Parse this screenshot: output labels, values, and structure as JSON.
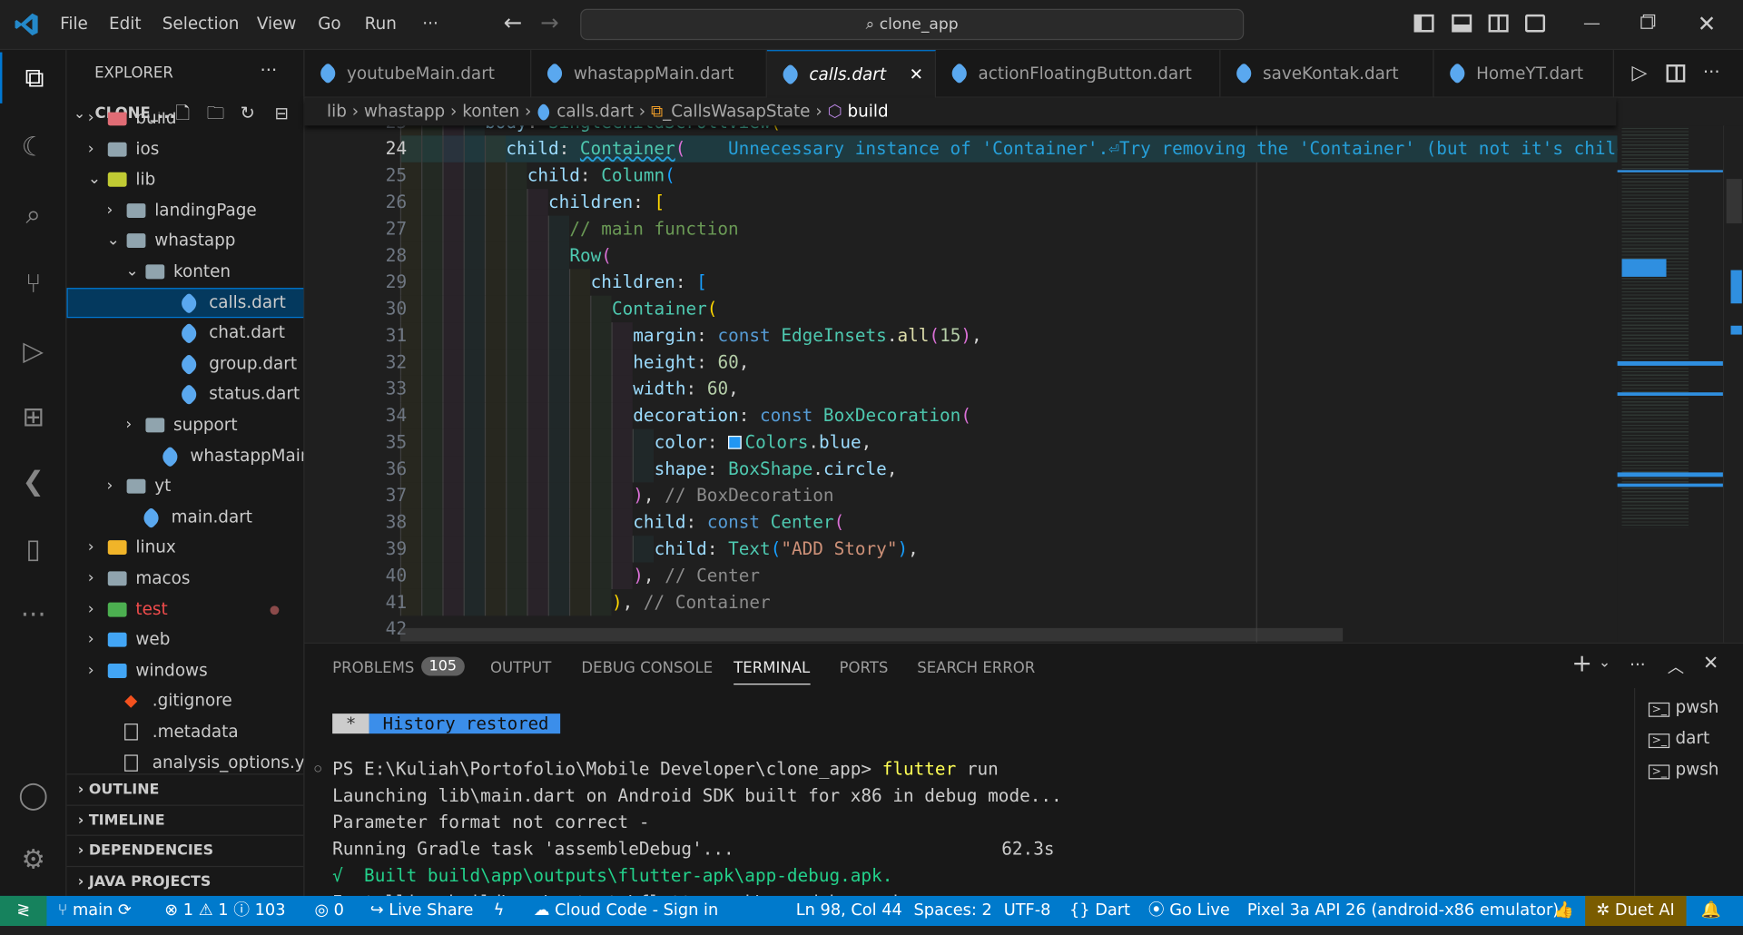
{
  "titlebar": {
    "menus": [
      "File",
      "Edit",
      "Selection",
      "View",
      "Go",
      "Run",
      "···"
    ],
    "search": "⌕ clone_app",
    "back_icon": "←",
    "forward_icon": "→"
  },
  "activity": {
    "items": [
      "explorer-icon",
      "run-history-icon",
      "search-icon",
      "source-control-icon",
      "run-debug-icon",
      "extensions-icon",
      "flutter-icon",
      "device-icon",
      "more-icon"
    ],
    "bottom": [
      "accounts-icon",
      "settings-icon"
    ]
  },
  "sidebar": {
    "title": "EXPLORER",
    "more": "···",
    "root": "CLONE_...",
    "items": [
      {
        "label": "build",
        "depth": 0,
        "type": "folder",
        "color": "#e06c75"
      },
      {
        "label": "ios",
        "depth": 0,
        "type": "folder"
      },
      {
        "label": "lib",
        "depth": 0,
        "type": "folder-open",
        "color": "#c0ca33"
      },
      {
        "label": "landingPage",
        "depth": 1,
        "type": "folder"
      },
      {
        "label": "whastapp",
        "depth": 1,
        "type": "folder-open"
      },
      {
        "label": "konten",
        "depth": 2,
        "type": "folder-open"
      },
      {
        "label": "calls.dart",
        "depth": 3,
        "type": "dart",
        "selected": true
      },
      {
        "label": "chat.dart",
        "depth": 3,
        "type": "dart"
      },
      {
        "label": "group.dart",
        "depth": 3,
        "type": "dart"
      },
      {
        "label": "status.dart",
        "depth": 3,
        "type": "dart"
      },
      {
        "label": "support",
        "depth": 2,
        "type": "folder"
      },
      {
        "label": "whastappMain....",
        "depth": 2,
        "type": "dart"
      },
      {
        "label": "yt",
        "depth": 1,
        "type": "folder"
      },
      {
        "label": "main.dart",
        "depth": 1,
        "type": "dart"
      },
      {
        "label": "linux",
        "depth": 0,
        "type": "folder",
        "color": "#f0b429"
      },
      {
        "label": "macos",
        "depth": 0,
        "type": "folder"
      },
      {
        "label": "test",
        "depth": 0,
        "type": "folder",
        "color": "#4caf50",
        "text_color": "#f14c4c",
        "dot": true
      },
      {
        "label": "web",
        "depth": 0,
        "type": "folder",
        "color": "#42a5f5"
      },
      {
        "label": "windows",
        "depth": 0,
        "type": "folder",
        "color": "#42a5f5"
      },
      {
        "label": ".gitignore",
        "depth": 0,
        "type": "git"
      },
      {
        "label": ".metadata",
        "depth": 0,
        "type": "file"
      },
      {
        "label": "analysis_options.y...",
        "depth": 0,
        "type": "file"
      }
    ],
    "sections": [
      "OUTLINE",
      "TIMELINE",
      "DEPENDENCIES",
      "JAVA PROJECTS"
    ]
  },
  "tabs": [
    {
      "label": "youtubeMain.dart"
    },
    {
      "label": "whastappMain.dart"
    },
    {
      "label": "calls.dart",
      "active": true
    },
    {
      "label": "actionFloatingButton.dart"
    },
    {
      "label": "saveKontak.dart"
    },
    {
      "label": "HomeYT.dart"
    }
  ],
  "breadcrumb": [
    "lib",
    "whastapp",
    "konten",
    "calls.dart",
    "_CallsWasapState",
    "build"
  ],
  "editor": {
    "lines": [
      {
        "n": "23",
        "indent": 8,
        "t": [
          [
            "body",
            "p"
          ],
          [
            ": ",
            "d"
          ],
          [
            "SingleChildScrollView",
            "c"
          ],
          [
            "(",
            "b1"
          ]
        ]
      },
      {
        "n": "24",
        "indent": 10,
        "current": true,
        "t": [
          [
            "child",
            "p"
          ],
          [
            ": ",
            "d"
          ],
          [
            "Container",
            "c"
          ],
          [
            "(",
            "b2"
          ],
          [
            "    Unnecessary instance of 'Container'.⏎Try removing the 'Container' (but not it's children) from the widget tree.",
            "diag"
          ]
        ]
      },
      {
        "n": "25",
        "indent": 12,
        "t": [
          [
            "child",
            "p"
          ],
          [
            ": ",
            "d"
          ],
          [
            "Column",
            "c"
          ],
          [
            "(",
            "b3"
          ]
        ]
      },
      {
        "n": "26",
        "indent": 14,
        "t": [
          [
            "children",
            "p"
          ],
          [
            ": ",
            "d"
          ],
          [
            "[",
            "b1"
          ]
        ]
      },
      {
        "n": "27",
        "indent": 16,
        "t": [
          [
            "// main function",
            "cm"
          ]
        ]
      },
      {
        "n": "28",
        "indent": 16,
        "t": [
          [
            "Row",
            "c"
          ],
          [
            "(",
            "b2"
          ]
        ]
      },
      {
        "n": "29",
        "indent": 18,
        "t": [
          [
            "children",
            "p"
          ],
          [
            ": ",
            "d"
          ],
          [
            "[",
            "b3"
          ]
        ]
      },
      {
        "n": "30",
        "indent": 20,
        "t": [
          [
            "Container",
            "c"
          ],
          [
            "(",
            "b1"
          ]
        ]
      },
      {
        "n": "31",
        "indent": 22,
        "t": [
          [
            "margin",
            "p"
          ],
          [
            ": ",
            "d"
          ],
          [
            "const ",
            "k"
          ],
          [
            "EdgeInsets",
            "c"
          ],
          [
            ".",
            "d"
          ],
          [
            "all",
            "f"
          ],
          [
            "(",
            "b2"
          ],
          [
            "15",
            "n"
          ],
          [
            ")",
            "b2"
          ],
          [
            ",",
            "d"
          ]
        ]
      },
      {
        "n": "32",
        "indent": 22,
        "t": [
          [
            "height",
            "p"
          ],
          [
            ": ",
            "d"
          ],
          [
            "60",
            "n"
          ],
          [
            ",",
            "d"
          ]
        ]
      },
      {
        "n": "33",
        "indent": 22,
        "t": [
          [
            "width",
            "p"
          ],
          [
            ": ",
            "d"
          ],
          [
            "60",
            "n"
          ],
          [
            ",",
            "d"
          ]
        ]
      },
      {
        "n": "34",
        "indent": 22,
        "t": [
          [
            "decoration",
            "p"
          ],
          [
            ": ",
            "d"
          ],
          [
            "const ",
            "k"
          ],
          [
            "BoxDecoration",
            "c"
          ],
          [
            "(",
            "b2"
          ]
        ]
      },
      {
        "n": "35",
        "indent": 24,
        "swatch": "#2196f3",
        "t": [
          [
            "color",
            "p"
          ],
          [
            ": ",
            "d"
          ],
          [
            "Colors",
            "c"
          ],
          [
            ".",
            "d"
          ],
          [
            "blue",
            "p"
          ],
          [
            ",",
            "d"
          ]
        ]
      },
      {
        "n": "36",
        "indent": 24,
        "t": [
          [
            "shape",
            "p"
          ],
          [
            ": ",
            "d"
          ],
          [
            "BoxShape",
            "c"
          ],
          [
            ".",
            "d"
          ],
          [
            "circle",
            "p"
          ],
          [
            ",",
            "d"
          ]
        ]
      },
      {
        "n": "37",
        "indent": 22,
        "t": [
          [
            ")",
            "b2"
          ],
          [
            ", ",
            "d"
          ],
          [
            "// BoxDecoration",
            "lbl"
          ]
        ]
      },
      {
        "n": "38",
        "indent": 22,
        "t": [
          [
            "child",
            "p"
          ],
          [
            ": ",
            "d"
          ],
          [
            "const ",
            "k"
          ],
          [
            "Center",
            "c"
          ],
          [
            "(",
            "b2"
          ]
        ]
      },
      {
        "n": "39",
        "indent": 24,
        "t": [
          [
            "child",
            "p"
          ],
          [
            ": ",
            "d"
          ],
          [
            "Text",
            "c"
          ],
          [
            "(",
            "b3"
          ],
          [
            "\"ADD Story\"",
            "s"
          ],
          [
            ")",
            "b3"
          ],
          [
            ",",
            "d"
          ]
        ]
      },
      {
        "n": "40",
        "indent": 22,
        "t": [
          [
            ")",
            "b2"
          ],
          [
            ", ",
            "d"
          ],
          [
            "// Center",
            "lbl"
          ]
        ]
      },
      {
        "n": "41",
        "indent": 20,
        "t": [
          [
            ")",
            "b1"
          ],
          [
            ", ",
            "d"
          ],
          [
            "// Container",
            "lbl"
          ]
        ]
      },
      {
        "n": "42",
        "indent": 0,
        "t": []
      }
    ]
  },
  "panel": {
    "tabs": [
      {
        "label": "PROBLEMS",
        "badge": "105"
      },
      {
        "label": "OUTPUT"
      },
      {
        "label": "DEBUG CONSOLE"
      },
      {
        "label": "TERMINAL",
        "active": true
      },
      {
        "label": "PORTS"
      },
      {
        "label": "SEARCH ERROR"
      }
    ],
    "terminal": {
      "history_star": "*",
      "history": "History restored",
      "prompt": "PS E:\\Kuliah\\Portofolio\\Mobile Developer\\clone_app> ",
      "command": "flutter",
      "command_args": " run",
      "lines": [
        "Launching lib\\main.dart on Android SDK built for x86 in debug mode...",
        "Parameter format not correct -",
        "Running Gradle task 'assembleDebug'..."
      ],
      "timer": "62.3s",
      "built": "√  Built build\\app\\outputs\\flutter-apk\\app-debug.apk.",
      "installing": "Installing build\\app\\outputs\\flutter-apk\\app-debug.apk..."
    },
    "terminals": [
      "pwsh",
      "dart",
      "pwsh"
    ]
  },
  "statusbar": {
    "branch": "main",
    "errors": "1",
    "warnings": "1",
    "infos": "103",
    "ports": "0",
    "live_share": "Live Share",
    "cloud_code": "Cloud Code - Sign in",
    "position": "Ln 98, Col 44",
    "spaces": "Spaces: 2",
    "encoding": "UTF-8",
    "language": "Dart",
    "go_live": "Go Live",
    "device": "Pixel 3a API 26 (android-x86 emulator)",
    "duet": "Duet AI"
  },
  "colors": {
    "accent": "#0078d4",
    "statusbar": "#007acc",
    "remote": "#16825d",
    "duet": "#7a5c00"
  }
}
